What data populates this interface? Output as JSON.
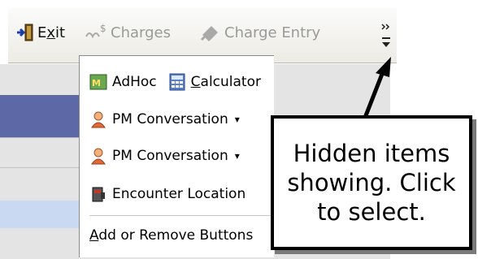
{
  "toolbar": {
    "exit_label": "Exit",
    "charges_label": "Charges",
    "charge_entry_label": "Charge Entry"
  },
  "menu": {
    "items": [
      {
        "label_a": "AdHoc",
        "label_b": "Calculator"
      },
      {
        "label": "PM Conversation"
      },
      {
        "label": "PM Conversation"
      },
      {
        "label": "Encounter Location"
      },
      {
        "label": "Add or Remove Buttons"
      }
    ]
  },
  "callout": {
    "line1": "Hidden items",
    "line2": "showing. Click",
    "line3": "to select."
  },
  "colors": {
    "accent_blue": "#5d69a6",
    "light_blue": "#c8d9f1",
    "disabled_text": "#9a9a9a"
  }
}
